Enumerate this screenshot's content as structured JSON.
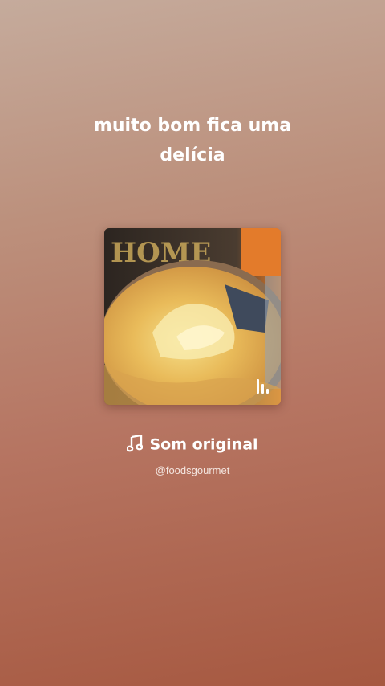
{
  "story": {
    "caption_lines": [
      "muito bom fica uma",
      "delícia"
    ]
  },
  "audio": {
    "note_icon": "music-note-icon",
    "title": "Som original",
    "handle": "@foodsgourmet",
    "cover_image": "food-dish-thumbnail",
    "playing_indicator_icon": "equalizer-bars-icon"
  },
  "colors": {
    "background_top": "#c5ab9c",
    "background_bottom": "#a65840",
    "text": "#ffffff"
  }
}
